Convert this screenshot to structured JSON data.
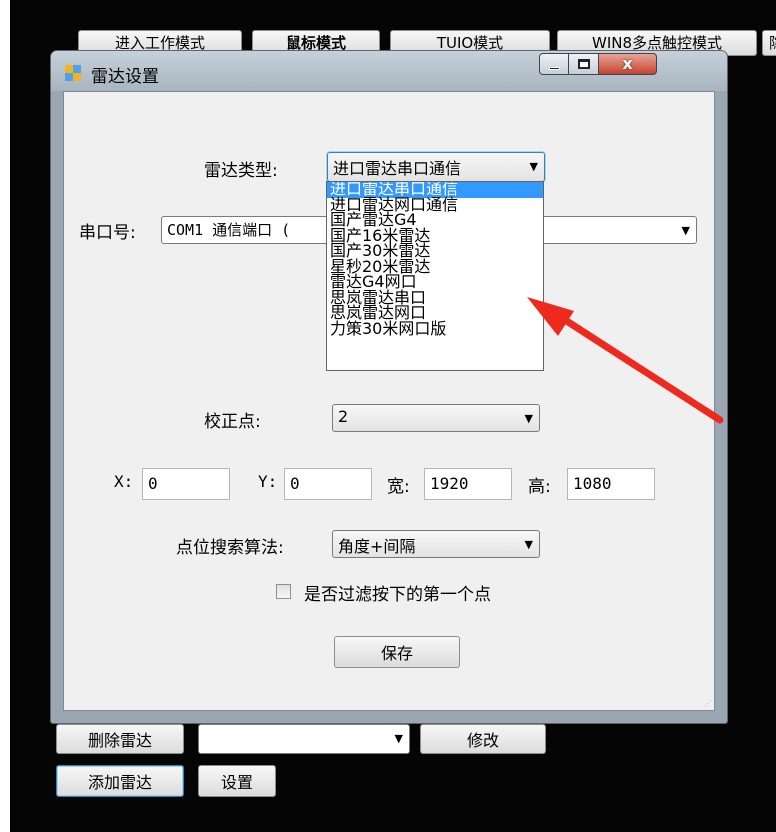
{
  "top_buttons": [
    "进入工作模式",
    "鼠标模式",
    "TUIO模式",
    "WIN8多点触控模式",
    "隐"
  ],
  "dialog": {
    "title": "雷达设置",
    "controls": {
      "minimize": "minimize",
      "maximize": "maximize",
      "close": "x"
    },
    "radar_type": {
      "label": "雷达类型:",
      "selected": "进口雷达串口通信",
      "options": [
        "进口雷达串口通信",
        "进口雷达网口通信",
        "国产雷达G4",
        "国产16米雷达",
        "国产30米雷达",
        "星秒20米雷达",
        "雷达G4网口",
        "思岚雷达串口",
        "思岚雷达网口",
        "力策30米网口版"
      ]
    },
    "serial_port": {
      "label": "串口号:",
      "value": "COM1 通信端口 ("
    },
    "calibration": {
      "label": "校正点:",
      "value": "2"
    },
    "fields": [
      {
        "label": "X:",
        "value": "0"
      },
      {
        "label": "Y:",
        "value": "0"
      },
      {
        "label": "宽:",
        "value": "1920"
      },
      {
        "label": "高:",
        "value": "1080"
      }
    ],
    "algorithm": {
      "label": "点位搜索算法:",
      "value": "角度+间隔"
    },
    "filter": {
      "label": "是否过滤按下的第一个点",
      "checked": false
    },
    "save_label": "保存"
  },
  "bottom": {
    "delete_label": "删除雷达",
    "combo_value": "",
    "modify_label": "修改",
    "add_label": "添加雷达",
    "settings_label": "设置"
  },
  "annotation_color": "#ee2a1f"
}
